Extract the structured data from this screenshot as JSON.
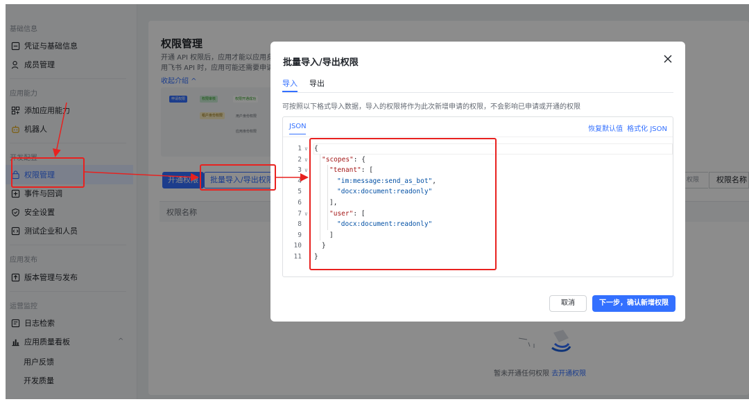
{
  "sidebar": {
    "groups": [
      "基础信息",
      "应用能力",
      "开发配置",
      "应用发布",
      "运营监控"
    ],
    "items": [
      {
        "label": "凭证与基础信息",
        "icon": "credential-icon"
      },
      {
        "label": "成员管理",
        "icon": "member-icon"
      },
      {
        "label": "添加应用能力",
        "icon": "grid-add-icon"
      },
      {
        "label": "机器人",
        "icon": "robot-icon"
      },
      {
        "label": "权限管理",
        "icon": "permission-icon"
      },
      {
        "label": "事件与回调",
        "icon": "event-icon"
      },
      {
        "label": "安全设置",
        "icon": "shield-icon"
      },
      {
        "label": "测试企业和人员",
        "icon": "test-icon"
      },
      {
        "label": "版本管理与发布",
        "icon": "publish-icon"
      },
      {
        "label": "日志检索",
        "icon": "log-icon"
      },
      {
        "label": "应用质量看板",
        "icon": "chart-icon"
      }
    ],
    "sub_items": [
      "用户反馈",
      "开发质量"
    ]
  },
  "main": {
    "title": "权限管理",
    "desc_line1": "开通 API 权限后，应用才能以应用身",
    "desc_line2": "用飞书 API 时，应用可能还需要申请",
    "collapse": "收起介绍 ^",
    "flow": {
      "step1": "申请权限",
      "step2": "权限审核",
      "step3": "权限开通成功",
      "step4": "租户身份权限",
      "step5": "用户身份权限",
      "step6": "应用身份权限"
    },
    "btn_open": "开通权限",
    "btn_batch": "批量导入/导出权限",
    "right_search": "权限名...",
    "right_col": "权限名称",
    "table_col": "权限名称",
    "empty_text": "暂未开通任何权限",
    "empty_link": "去开通权限"
  },
  "modal": {
    "title": "批量导入/导出权限",
    "tab_import": "导入",
    "tab_export": "导出",
    "hint": "可按照以下格式导入数据，导入的权限将作为此次新增申请的权限，不会影响已申请或开通的权限",
    "editor_tab": "JSON",
    "action_restore": "恢复默认值",
    "action_format": "格式化 JSON",
    "code": [
      {
        "n": "1",
        "fold": true,
        "indent": 0,
        "parts": [
          {
            "t": "{",
            "c": "p"
          }
        ]
      },
      {
        "n": "2",
        "fold": true,
        "indent": 1,
        "parts": [
          {
            "t": "\"scopes\"",
            "c": "k"
          },
          {
            "t": ": {",
            "c": "p"
          }
        ]
      },
      {
        "n": "3",
        "fold": true,
        "indent": 2,
        "parts": [
          {
            "t": "\"tenant\"",
            "c": "k"
          },
          {
            "t": ": [",
            "c": "p"
          }
        ]
      },
      {
        "n": "4",
        "fold": false,
        "indent": 3,
        "parts": [
          {
            "t": "\"im:message:send_as_bot\"",
            "c": "s"
          },
          {
            "t": ",",
            "c": "p"
          }
        ]
      },
      {
        "n": "5",
        "fold": false,
        "indent": 3,
        "parts": [
          {
            "t": "\"docx:document:readonly\"",
            "c": "s"
          }
        ]
      },
      {
        "n": "6",
        "fold": false,
        "indent": 2,
        "parts": [
          {
            "t": "],",
            "c": "p"
          }
        ]
      },
      {
        "n": "7",
        "fold": true,
        "indent": 2,
        "parts": [
          {
            "t": "\"user\"",
            "c": "k"
          },
          {
            "t": ": [",
            "c": "p"
          }
        ]
      },
      {
        "n": "8",
        "fold": false,
        "indent": 3,
        "parts": [
          {
            "t": "\"docx:document:readonly\"",
            "c": "s"
          }
        ]
      },
      {
        "n": "9",
        "fold": false,
        "indent": 2,
        "parts": [
          {
            "t": "]",
            "c": "p"
          }
        ]
      },
      {
        "n": "10",
        "fold": false,
        "indent": 1,
        "parts": [
          {
            "t": "}",
            "c": "p"
          }
        ]
      },
      {
        "n": "11",
        "fold": false,
        "indent": 0,
        "parts": [
          {
            "t": "}",
            "c": "p"
          }
        ]
      }
    ],
    "btn_cancel": "取消",
    "btn_next": "下一步，确认新增权限"
  },
  "colors": {
    "accent": "#3370ff",
    "annotation": "#e8211f"
  }
}
